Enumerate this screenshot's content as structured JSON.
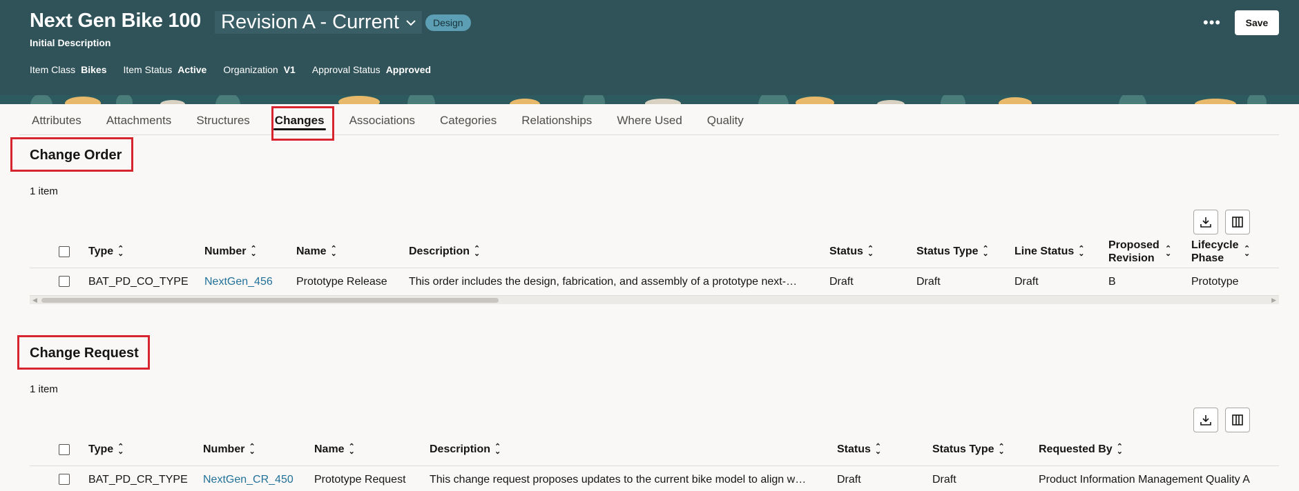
{
  "header": {
    "title": "Next Gen Bike 100",
    "revision": "Revision A - Current",
    "badge": "Design",
    "subtitle": "Initial Description",
    "meta": [
      {
        "label": "Item Class",
        "value": "Bikes"
      },
      {
        "label": "Item Status",
        "value": "Active"
      },
      {
        "label": "Organization",
        "value": "V1"
      },
      {
        "label": "Approval Status",
        "value": "Approved"
      }
    ],
    "more_label": "•••",
    "save_label": "Save"
  },
  "tabs": [
    "Attributes",
    "Attachments",
    "Structures",
    "Changes",
    "Associations",
    "Categories",
    "Relationships",
    "Where Used",
    "Quality"
  ],
  "change_order": {
    "title": "Change Order",
    "count": "1 item",
    "columns": [
      "Type",
      "Number",
      "Name",
      "Description",
      "Status",
      "Status Type",
      "Line Status",
      "Proposed Revision",
      "Lifecycle Phase"
    ],
    "row": {
      "type": "BAT_PD_CO_TYPE",
      "number": "NextGen_456",
      "name": "Prototype Release",
      "description": "This order includes the design, fabrication, and assembly of a prototype next-…",
      "status": "Draft",
      "status_type": "Draft",
      "line_status": "Draft",
      "proposed_revision": "B",
      "lifecycle_phase": "Prototype"
    }
  },
  "change_request": {
    "title": "Change Request",
    "count": "1 item",
    "columns": [
      "Type",
      "Number",
      "Name",
      "Description",
      "Status",
      "Status Type",
      "Requested By"
    ],
    "row": {
      "type": "BAT_PD_CR_TYPE",
      "number": "NextGen_CR_450",
      "name": "Prototype Request",
      "description": "This change request proposes updates to the current bike model to align w…",
      "status": "Draft",
      "status_type": "Draft",
      "requested_by": "Product Information Management Quality A"
    }
  },
  "colors": {
    "header_bg": "#30535a",
    "highlight": "#d8242e",
    "link": "#227199",
    "badge": "#5c9fb5"
  },
  "icons": [
    "chevron-down-icon",
    "more-options-icon",
    "download-icon",
    "columns-icon",
    "sort-icon"
  ]
}
